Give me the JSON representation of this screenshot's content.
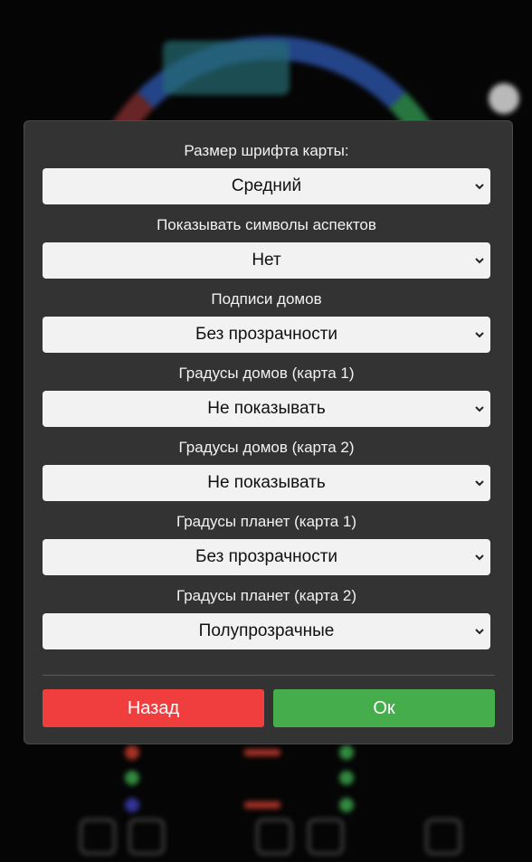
{
  "dialog": {
    "fields": [
      {
        "label": "Размер шрифта карты:",
        "value": "Средний"
      },
      {
        "label": "Показывать символы аспектов",
        "value": "Нет"
      },
      {
        "label": "Подписи домов",
        "value": "Без прозрачности"
      },
      {
        "label": "Градусы домов (карта 1)",
        "value": "Не показывать"
      },
      {
        "label": "Градусы домов (карта 2)",
        "value": "Не показывать"
      },
      {
        "label": "Градусы планет (карта 1)",
        "value": "Без прозрачности"
      },
      {
        "label": "Градусы планет (карта 2)",
        "value": "Полупрозрачные"
      }
    ],
    "back_label": "Назад",
    "ok_label": "Ок"
  },
  "colors": {
    "dialog_bg": "#333333",
    "back_button": "#f03e3e",
    "ok_button": "#46ad4c",
    "select_bg": "#f2f2f2"
  },
  "icons": [
    "chevron-down-icon"
  ]
}
